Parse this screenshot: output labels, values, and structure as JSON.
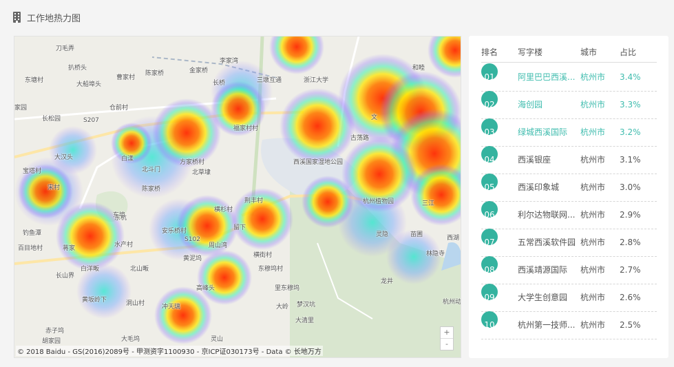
{
  "header": {
    "icon": "building-icon",
    "title": "工作地热力图"
  },
  "map": {
    "labels": [
      {
        "text": "刀毛弄"
      },
      {
        "text": "扒桥头"
      },
      {
        "text": "曹家村"
      },
      {
        "text": "陈家桥"
      },
      {
        "text": "金家桥"
      },
      {
        "text": "李家湾"
      },
      {
        "text": "东塘村"
      },
      {
        "text": "大船埠头"
      },
      {
        "text": "长桥"
      },
      {
        "text": "三墩互通"
      },
      {
        "text": "浙江大学"
      },
      {
        "text": "和睦"
      },
      {
        "text": "家园"
      },
      {
        "text": "长松园"
      },
      {
        "text": "仓前村"
      },
      {
        "text": "S207"
      },
      {
        "text": "福家村村"
      },
      {
        "text": "古荡路"
      },
      {
        "text": "文"
      },
      {
        "text": "大汉头"
      },
      {
        "text": "白漾"
      },
      {
        "text": "方家桥村"
      },
      {
        "text": "西溪国家湿地公园"
      },
      {
        "text": "宝塔村"
      },
      {
        "text": "北斗门"
      },
      {
        "text": "北草埭"
      },
      {
        "text": "宋村"
      },
      {
        "text": "东埠"
      },
      {
        "text": "陈家桥"
      },
      {
        "text": "荆丰村"
      },
      {
        "text": "杭州植物园"
      },
      {
        "text": "三江"
      },
      {
        "text": "钓鱼潭"
      },
      {
        "text": "东杭"
      },
      {
        "text": "横杉村"
      },
      {
        "text": "安乐桥村"
      },
      {
        "text": "留下"
      },
      {
        "text": "灵隐"
      },
      {
        "text": "苗圃"
      },
      {
        "text": "西湖"
      },
      {
        "text": "百目地村"
      },
      {
        "text": "蒋家"
      },
      {
        "text": "水产村"
      },
      {
        "text": "S102"
      },
      {
        "text": "周山湾"
      },
      {
        "text": "横街村"
      },
      {
        "text": "林隐寺"
      },
      {
        "text": "白洋畈"
      },
      {
        "text": "北山畈"
      },
      {
        "text": "黄泥坞"
      },
      {
        "text": "东穆坞村"
      },
      {
        "text": "长山界"
      },
      {
        "text": "龙井"
      },
      {
        "text": "高峰头"
      },
      {
        "text": "里东穆坞"
      },
      {
        "text": "黄坂岭下"
      },
      {
        "text": "洞山村"
      },
      {
        "text": "冲天璃"
      },
      {
        "text": "大岭"
      },
      {
        "text": "梦汉坑"
      },
      {
        "text": "大清里"
      },
      {
        "text": "杭州动"
      },
      {
        "text": "赤子坞"
      },
      {
        "text": "胡家园"
      },
      {
        "text": "大毛坞"
      },
      {
        "text": "灵山"
      }
    ],
    "copyright": "© 2018 Baidu - GS(2016)2089号 - 甲测资字1100930 - 京ICP证030173号 - Data © 长地万方",
    "zoom_in": "+",
    "zoom_out": "-"
  },
  "table": {
    "headers": {
      "rank": "排名",
      "building": "写字楼",
      "city": "城市",
      "pct": "占比"
    },
    "rows": [
      {
        "rank": "01",
        "building": "阿里巴巴西溪...",
        "city": "杭州市",
        "pct": "3.4%"
      },
      {
        "rank": "02",
        "building": "海创园",
        "city": "杭州市",
        "pct": "3.3%"
      },
      {
        "rank": "03",
        "building": "绿城西溪国际",
        "city": "杭州市",
        "pct": "3.2%"
      },
      {
        "rank": "04",
        "building": "西溪银座",
        "city": "杭州市",
        "pct": "3.1%"
      },
      {
        "rank": "05",
        "building": "西溪印象城",
        "city": "杭州市",
        "pct": "3.0%"
      },
      {
        "rank": "06",
        "building": "利尔达物联网...",
        "city": "杭州市",
        "pct": "2.9%"
      },
      {
        "rank": "07",
        "building": "五常西溪软件园",
        "city": "杭州市",
        "pct": "2.8%"
      },
      {
        "rank": "08",
        "building": "西溪靖源国际",
        "city": "杭州市",
        "pct": "2.7%"
      },
      {
        "rank": "09",
        "building": "大学生创意园",
        "city": "杭州市",
        "pct": "2.6%"
      },
      {
        "rank": "10",
        "building": "杭州第一技师...",
        "city": "杭州市",
        "pct": "2.5%"
      }
    ]
  },
  "colors": {
    "accent": "#34b39f",
    "highlight_text": "#3fbcae",
    "heat_hot": "#ff3a00",
    "heat_cool": "#8a6cff"
  }
}
